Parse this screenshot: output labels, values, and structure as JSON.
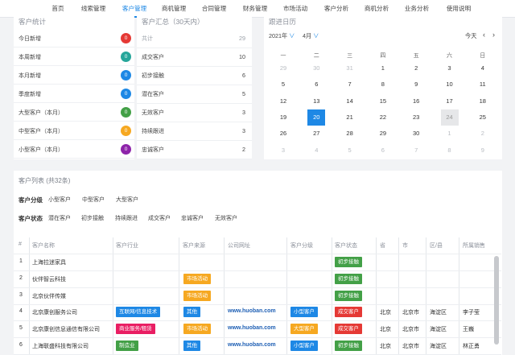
{
  "nav": [
    "首页",
    "线索管理",
    "客户管理",
    "商机管理",
    "合同管理",
    "财务管理",
    "市场活动",
    "客户分析",
    "商机分析",
    "业务分析",
    "使用说明"
  ],
  "stats": {
    "title": "客户统计",
    "rows": [
      {
        "label": "今日新增",
        "count": "0",
        "color": "#e53935"
      },
      {
        "label": "本周新增",
        "count": "0",
        "color": "#26a69a"
      },
      {
        "label": "本月新增",
        "count": "0",
        "color": "#1e88e5"
      },
      {
        "label": "季度新增",
        "count": "0",
        "color": "#1e88e5"
      },
      {
        "label": "大型客户（本月）",
        "count": "0",
        "color": "#43a047"
      },
      {
        "label": "中型客户（本月）",
        "count": "0",
        "color": "#f6a821"
      },
      {
        "label": "小型客户（本月）",
        "count": "0",
        "color": "#8e24aa"
      }
    ]
  },
  "summary": {
    "title": "客户汇总（30天内）",
    "rows": [
      {
        "label": "共计",
        "value": "29",
        "muted": true
      },
      {
        "label": "成交客户",
        "value": "10"
      },
      {
        "label": "初步接触",
        "value": "6"
      },
      {
        "label": "潜在客户",
        "value": "5"
      },
      {
        "label": "无效客户",
        "value": "3"
      },
      {
        "label": "持续跟进",
        "value": "3"
      },
      {
        "label": "忠诚客户",
        "value": "2"
      }
    ]
  },
  "calendar": {
    "title": "跟进日历",
    "year": "2021年",
    "month": "4月",
    "today_btn": "今天",
    "weekdays": [
      "一",
      "二",
      "三",
      "四",
      "五",
      "六",
      "日"
    ],
    "weeks": [
      [
        {
          "d": "29",
          "o": 1
        },
        {
          "d": "30",
          "o": 1
        },
        {
          "d": "31",
          "o": 1
        },
        {
          "d": "1"
        },
        {
          "d": "2"
        },
        {
          "d": "3"
        },
        {
          "d": "4"
        }
      ],
      [
        {
          "d": "5"
        },
        {
          "d": "6"
        },
        {
          "d": "7"
        },
        {
          "d": "8"
        },
        {
          "d": "9"
        },
        {
          "d": "10"
        },
        {
          "d": "11"
        }
      ],
      [
        {
          "d": "12"
        },
        {
          "d": "13"
        },
        {
          "d": "14"
        },
        {
          "d": "15"
        },
        {
          "d": "16"
        },
        {
          "d": "17"
        },
        {
          "d": "18"
        }
      ],
      [
        {
          "d": "19"
        },
        {
          "d": "20",
          "t": 1
        },
        {
          "d": "21"
        },
        {
          "d": "22"
        },
        {
          "d": "23"
        },
        {
          "d": "24",
          "s": 1
        },
        {
          "d": "25"
        }
      ],
      [
        {
          "d": "26"
        },
        {
          "d": "27"
        },
        {
          "d": "28"
        },
        {
          "d": "29"
        },
        {
          "d": "30"
        },
        {
          "d": "1",
          "o": 1
        },
        {
          "d": "2",
          "o": 1
        }
      ],
      [
        {
          "d": "3",
          "o": 1
        },
        {
          "d": "4",
          "o": 1
        },
        {
          "d": "5",
          "o": 1
        },
        {
          "d": "6",
          "o": 1
        },
        {
          "d": "7",
          "o": 1
        },
        {
          "d": "8",
          "o": 1
        },
        {
          "d": "9",
          "o": 1
        }
      ]
    ]
  },
  "list": {
    "title": "客户列表 (共32条)",
    "grade_label": "客户分级",
    "grades": [
      "小型客户",
      "中型客户",
      "大型客户"
    ],
    "status_label": "客户状态",
    "statuses": [
      "潜在客户",
      "初步接触",
      "持续跟进",
      "成交客户",
      "忠诚客户",
      "无效客户"
    ],
    "columns": [
      "#",
      "客户名称",
      "客户行业",
      "客户来源",
      "公司网址",
      "客户分级",
      "客户状态",
      "省",
      "市",
      "区/县",
      "所属销售"
    ],
    "rows": [
      {
        "no": "1",
        "name": "上海拉迷家具",
        "industry": "",
        "source": "",
        "url": "",
        "grade": "",
        "status": "初步接触",
        "prov": "",
        "city": "",
        "dist": "",
        "sales": ""
      },
      {
        "no": "2",
        "name": "伙伴智云科技",
        "industry": "",
        "source": "市场活动",
        "url": "",
        "grade": "",
        "status": "初步接触",
        "prov": "",
        "city": "",
        "dist": "",
        "sales": ""
      },
      {
        "no": "3",
        "name": "北京伙伴传媒",
        "industry": "",
        "source": "市场活动",
        "url": "",
        "grade": "",
        "status": "初步接触",
        "prov": "",
        "city": "",
        "dist": "",
        "sales": ""
      },
      {
        "no": "4",
        "name": "北京康创服务公司",
        "industry": "互联网/信息技术",
        "source": "其他",
        "url": "www.huoban.com",
        "grade": "小型客户",
        "status": "成交客户",
        "prov": "北京",
        "city": "北京市",
        "dist": "海淀区",
        "sales": "李子莹"
      },
      {
        "no": "5",
        "name": "北京康创信息通信有限公司",
        "industry": "商业服务/租赁",
        "source": "市场活动",
        "url": "www.huoban.com",
        "grade": "大型客户",
        "status": "成交客户",
        "prov": "北京",
        "city": "北京市",
        "dist": "海淀区",
        "sales": "王巍"
      },
      {
        "no": "6",
        "name": "上海联盛科技有限公司",
        "industry": "制造业",
        "source": "其他",
        "url": "www.huoban.com",
        "grade": "小型客户",
        "status": "初步接触",
        "prov": "北京",
        "city": "北京市",
        "dist": "海淀区",
        "sales": "林正勇"
      }
    ]
  },
  "tag_colors": {
    "互联网/信息技术": "#1e88e5",
    "商业服务/租赁": "#e91e63",
    "制造业": "#43a047",
    "市场活动": "#f6a821",
    "其他": "#1e88e5",
    "小型客户": "#1e88e5",
    "大型客户": "#f6a821",
    "成交客户": "#e53935",
    "初步接触": "#43a047"
  }
}
